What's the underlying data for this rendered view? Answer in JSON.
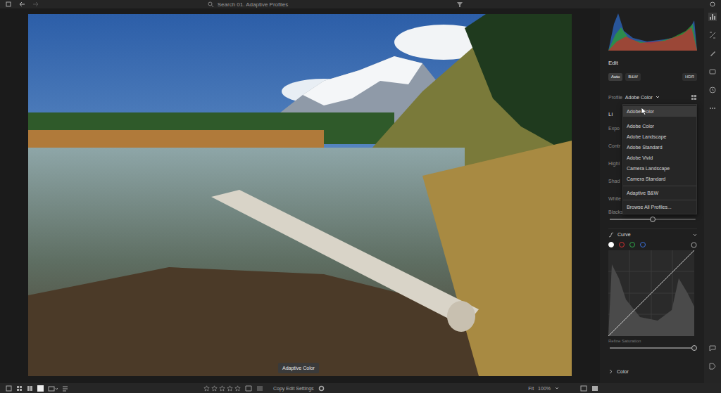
{
  "topbar": {
    "search": "Search 01. Adaptive Profiles"
  },
  "edit": {
    "title": "Edit",
    "modes": [
      {
        "label": "Auto",
        "selected": true
      },
      {
        "label": "B&W",
        "selected": false
      },
      {
        "label": "HDR",
        "selected": false
      }
    ]
  },
  "profile": {
    "label": "Profile",
    "value": "Adobe Color"
  },
  "profile_menu": [
    {
      "label": "Adobe Color",
      "selected": true,
      "kind": "item"
    },
    {
      "label": "Adobe Color",
      "selected": false,
      "kind": "item"
    },
    {
      "label": "Adobe Landscape",
      "selected": false,
      "kind": "item"
    },
    {
      "label": "Adobe Standard",
      "selected": false,
      "kind": "item"
    },
    {
      "label": "Adobe Vivid",
      "selected": false,
      "kind": "item"
    },
    {
      "label": "Camera Landscape",
      "selected": false,
      "kind": "item"
    },
    {
      "label": "Camera Standard",
      "selected": false,
      "kind": "item"
    },
    {
      "label": "Adaptive B&W",
      "selected": false,
      "kind": "item"
    },
    {
      "label": "Browse All Profiles...",
      "selected": false,
      "kind": "item"
    }
  ],
  "light": {
    "title": "Li",
    "rows": [
      "Expo",
      "Contr",
      "Highl",
      "Shad",
      "White"
    ]
  },
  "blacks": {
    "label": "Blacks",
    "level": 0.5
  },
  "curve": {
    "title": "Curve",
    "channels": [
      {
        "color": "#ffffff",
        "selected": true
      },
      {
        "color": "#d03030",
        "selected": false
      },
      {
        "color": "#2fa84a",
        "selected": false
      },
      {
        "color": "#3a6fd8",
        "selected": false
      }
    ]
  },
  "refine": {
    "label": "Refine Saturation",
    "level": 0.98
  },
  "color_section": {
    "title": "Color"
  },
  "tooltip": "Adaptive Color",
  "bottombar": {
    "stars": 0,
    "copy": "Copy Edit Settings",
    "fit": "Fit",
    "zoom": "100%"
  }
}
